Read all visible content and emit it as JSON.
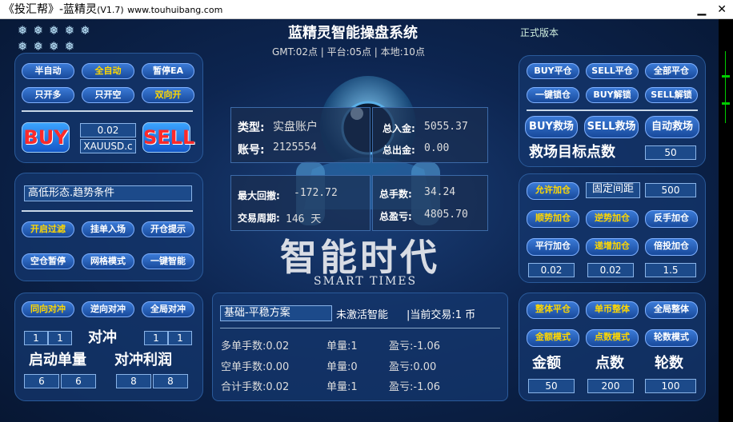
{
  "window": {
    "title": "《投汇帮》-蓝精灵",
    "version": "(V1.7)",
    "url": "www.touhuibang.com"
  },
  "header": {
    "title": "蓝精灵智能操盘系统",
    "time_info": "GMT:02点 | 平台:05点 | 本地:10点",
    "version_label": "正式版本"
  },
  "left_top": {
    "semi_auto": "半自动",
    "full_auto": "全自动",
    "pause_ea": "暂停EA",
    "only_long": "只开多",
    "only_short": "只开空",
    "both_open": "双向开",
    "buy": "BUY",
    "sell": "SELL",
    "lot": "0.02",
    "symbol": "XAUUSD.c"
  },
  "left_mid": {
    "condition": "高低形态.趋势条件",
    "open_filter": "开启过滤",
    "pending_entry": "挂单入场",
    "open_alert": "开仓提示",
    "flat_pause": "空仓暂停",
    "grid_mode": "网格模式",
    "one_click_smart": "一键智能"
  },
  "left_bot": {
    "same_hedge": "同向对冲",
    "reverse_hedge": "逆向对冲",
    "global_hedge": "全局对冲",
    "hedge_label": "对冲",
    "start_lot_label": "启动单量",
    "hedge_profit_label": "对冲利润",
    "v1": "1",
    "v2": "1",
    "v3": "1",
    "v4": "1",
    "v5": "6",
    "v6": "6",
    "v7": "8",
    "v8": "8"
  },
  "account": {
    "type_label": "类型:",
    "type_value": "实盘账户",
    "acct_label": "账号:",
    "acct_value": "2125554",
    "deposit_label": "总入金:",
    "deposit_value": "5055.37",
    "withdraw_label": "总出金:",
    "withdraw_value": "0.00",
    "dd_label": "最大回撤:",
    "dd_value": "-172.72",
    "cycle_label": "交易周期:",
    "cycle_value": "146 天",
    "hands_label": "总手数:",
    "hands_value": "34.24",
    "profit_label": "总盈亏:",
    "profit_value": "4805.70"
  },
  "brand": {
    "cn": "智能时代",
    "en": "SMART TIMES"
  },
  "plan": {
    "name": "基础-平稳方案",
    "status": "未激活智能",
    "current": "|当前交易:1 币"
  },
  "stats": {
    "r1": [
      "多单手数:0.02",
      "单量:1",
      "盈亏:-1.06"
    ],
    "r2": [
      "空单手数:0.00",
      "单量:0",
      "盈亏:0.00"
    ],
    "r3": [
      "合计手数:0.02",
      "单量:1",
      "盈亏:-1.06"
    ]
  },
  "right_top": {
    "buy_close": "BUY平仓",
    "sell_close": "SELL平仓",
    "all_close": "全部平仓",
    "one_lock": "一键锁仓",
    "buy_unlock": "BUY解锁",
    "sell_unlock": "SELL解锁",
    "buy_rescue": "BUY救场",
    "sell_rescue": "SELL救场",
    "auto_rescue": "自动救场",
    "rescue_label": "救场目标点数",
    "rescue_value": "50"
  },
  "right_mid": {
    "allow_add": "允许加仓",
    "fixed_dist": "固定间距",
    "dist_value": "500",
    "trend_add": "顺势加仓",
    "counter_add": "逆势加仓",
    "reverse_add": "反手加仓",
    "parallel_add": "平行加仓",
    "incr_add": "递增加仓",
    "multi_add": "倍投加仓",
    "v1": "0.02",
    "v2": "0.02",
    "v3": "1.5"
  },
  "right_bot": {
    "whole_close": "整体平仓",
    "single_whole": "单币整体",
    "global_whole": "全局整体",
    "amount_mode": "金额模式",
    "points_mode": "点数模式",
    "rounds_mode": "轮数模式",
    "amount_label": "金额",
    "points_label": "点数",
    "rounds_label": "轮数",
    "amount_value": "50",
    "points_value": "200",
    "rounds_value": "100"
  }
}
